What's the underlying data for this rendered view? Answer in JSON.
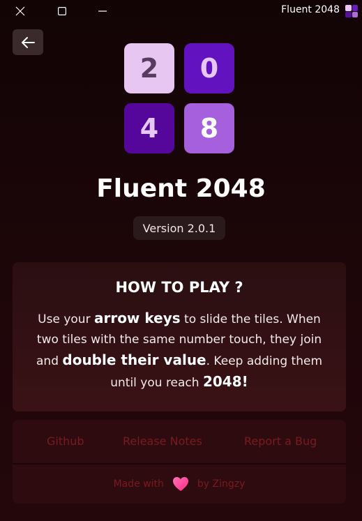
{
  "window": {
    "title": "Fluent 2048",
    "logo_colors": [
      "#e7c6f2",
      "#6a1ec0",
      "#5a0fa0",
      "#b06ae0"
    ]
  },
  "titlebar": {
    "close_icon": "close-icon",
    "maximize_icon": "maximize-icon",
    "minimize_icon": "minimize-icon"
  },
  "back_button": {
    "icon": "arrow-left-icon"
  },
  "logo": {
    "tiles": [
      {
        "digit": "2",
        "bg": "#e7c6f2",
        "fg": "#5a3b60"
      },
      {
        "digit": "0",
        "bg": "#6312bf",
        "fg": "#e5c8f5"
      },
      {
        "digit": "4",
        "bg": "#55079b",
        "fg": "#e5c8f5"
      },
      {
        "digit": "8",
        "bg": "#a65fdd",
        "fg": "#ffffff"
      }
    ]
  },
  "app": {
    "name": "Fluent 2048",
    "version": "Version 2.0.1"
  },
  "how_to_play": {
    "title": "HOW TO PLAY ?",
    "t1": "Use your ",
    "b1": "arrow keys",
    "t2": " to slide the tiles. When two tiles with the same number touch, they join and ",
    "b2": "double their value",
    "t3": ". Keep adding them until you reach ",
    "b3": "2048!"
  },
  "links": {
    "github": "Github",
    "release_notes": "Release Notes",
    "report_bug": "Report a Bug"
  },
  "footer": {
    "made_with": "Made with",
    "by": "by Zingzy",
    "heart_icon": "heart-icon"
  },
  "colors": {
    "link": "#7a1a22",
    "heart": "#ff4fa0"
  }
}
